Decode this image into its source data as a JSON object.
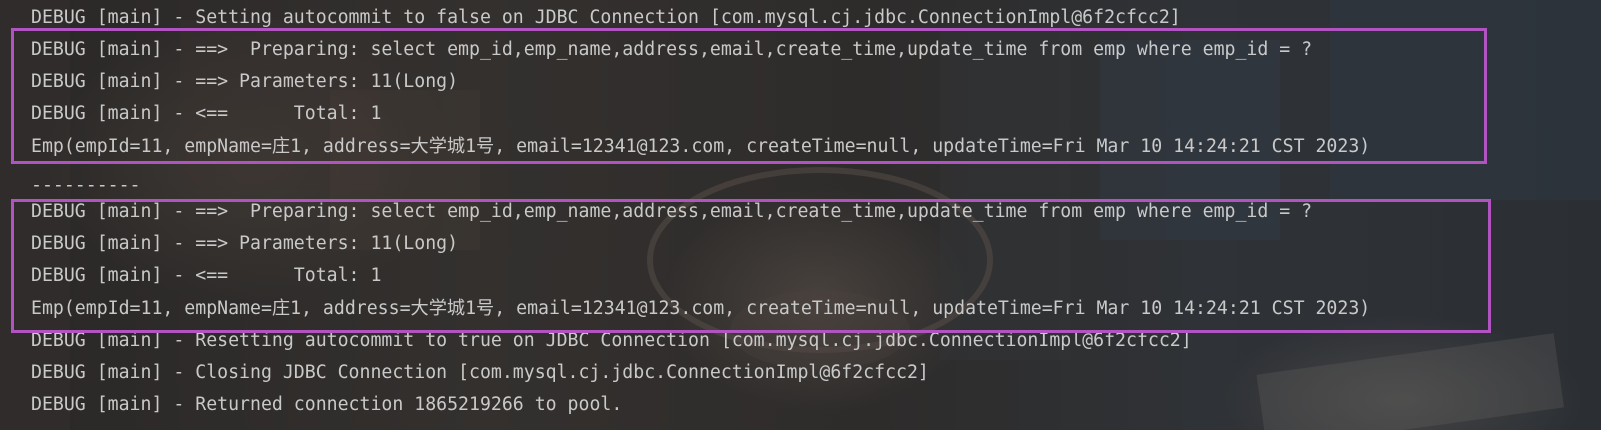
{
  "console": {
    "lines": [
      "DEBUG [main] - Setting autocommit to false on JDBC Connection [com.mysql.cj.jdbc.ConnectionImpl@6f2cfcc2]",
      "DEBUG [main] - ==>  Preparing: select emp_id,emp_name,address,email,create_time,update_time from emp where emp_id = ?",
      "DEBUG [main] - ==> Parameters: 11(Long)",
      "DEBUG [main] - <==      Total: 1",
      "Emp(empId=11, empName=庄1, address=大学城1号, email=12341@123.com, createTime=null, updateTime=Fri Mar 10 14:24:21 CST 2023)",
      "----------",
      "DEBUG [main] - ==>  Preparing: select emp_id,emp_name,address,email,create_time,update_time from emp where emp_id = ?",
      "DEBUG [main] - ==> Parameters: 11(Long)",
      "DEBUG [main] - <==      Total: 1",
      "Emp(empId=11, empName=庄1, address=大学城1号, email=12341@123.com, createTime=null, updateTime=Fri Mar 10 14:24:21 CST 2023)",
      "DEBUG [main] - Resetting autocommit to true on JDBC Connection [com.mysql.cj.jdbc.ConnectionImpl@6f2cfcc2]",
      "DEBUG [main] - Closing JDBC Connection [com.mysql.cj.jdbc.ConnectionImpl@6f2cfcc2]",
      "DEBUG [main] - Returned connection 1865219266 to pool."
    ]
  },
  "colors": {
    "text": "#c9c9c9",
    "highlight_box": "#b154c1",
    "background": "#2b2b2b"
  }
}
